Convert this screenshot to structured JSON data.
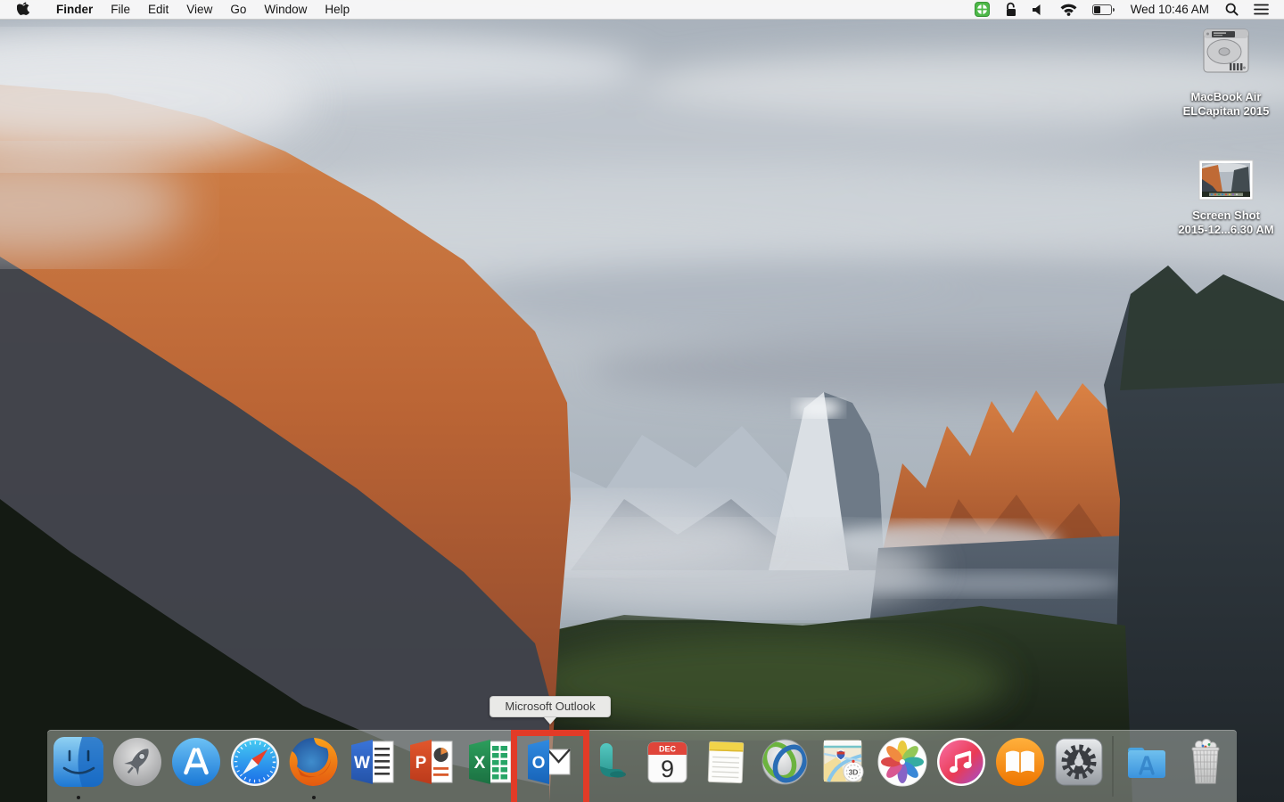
{
  "menu_bar": {
    "apple_menu": "apple-logo",
    "menus": [
      "Finder",
      "File",
      "Edit",
      "View",
      "Go",
      "Window",
      "Help"
    ],
    "active_app": "Finder",
    "status": {
      "time": "Wed 10:46 AM",
      "battery_percent": 35,
      "icons": [
        "antivirus-shield",
        "lock-open",
        "volume",
        "wifi",
        "battery",
        "spotlight-search",
        "notification-center"
      ],
      "antivirus_color": "#4db848"
    }
  },
  "desktop_icons": [
    {
      "name": "hard-drive",
      "label_line1": "MacBook Air",
      "label_line2": "ELCapitan 2015"
    },
    {
      "name": "screenshot-file",
      "label_line1": "Screen Shot",
      "label_line2": "2015-12...6.30 AM"
    }
  ],
  "tooltip": {
    "text": "Microsoft Outlook",
    "points_to": "outlook-dock-icon"
  },
  "dock": {
    "items": [
      {
        "name": "finder",
        "label": "Finder",
        "running": true
      },
      {
        "name": "launchpad",
        "label": "Launchpad",
        "running": false
      },
      {
        "name": "app-store",
        "label": "App Store",
        "running": false
      },
      {
        "name": "safari",
        "label": "Safari",
        "running": false
      },
      {
        "name": "firefox",
        "label": "Firefox",
        "running": true
      },
      {
        "name": "word",
        "label": "Microsoft Word",
        "letter": "W",
        "running": false
      },
      {
        "name": "powerpoint",
        "label": "Microsoft PowerPoint",
        "letter": "P",
        "running": false
      },
      {
        "name": "excel",
        "label": "Microsoft Excel",
        "letter": "X",
        "running": false
      },
      {
        "name": "outlook",
        "label": "Microsoft Outlook",
        "letter": "O",
        "running": false,
        "highlighted": true
      },
      {
        "name": "lync",
        "label": "Microsoft Lync",
        "running": false
      },
      {
        "name": "calendar",
        "label": "Calendar",
        "month": "DEC",
        "day": "9",
        "running": false
      },
      {
        "name": "notes",
        "label": "Notes",
        "running": false
      },
      {
        "name": "cisco-anyconnect",
        "label": "Cisco AnyConnect",
        "running": false
      },
      {
        "name": "maps",
        "label": "Maps",
        "badge": "3D",
        "running": false
      },
      {
        "name": "photos",
        "label": "Photos",
        "running": false
      },
      {
        "name": "itunes",
        "label": "iTunes",
        "running": false
      },
      {
        "name": "ibooks",
        "label": "iBooks",
        "running": false
      },
      {
        "name": "system-preferences",
        "label": "System Preferences",
        "running": false
      },
      {
        "name": "applications-folder",
        "label": "Applications",
        "running": false
      },
      {
        "name": "trash",
        "label": "Trash",
        "full": true,
        "running": false
      }
    ],
    "highlight_color": "#e23b27"
  },
  "colors": {
    "menubar_bg": "#f8f8f8",
    "dock_bg": "rgba(196,202,193,0.45)",
    "tooltip_bg": "#e9e9e7",
    "highlight_red": "#e23b27"
  }
}
